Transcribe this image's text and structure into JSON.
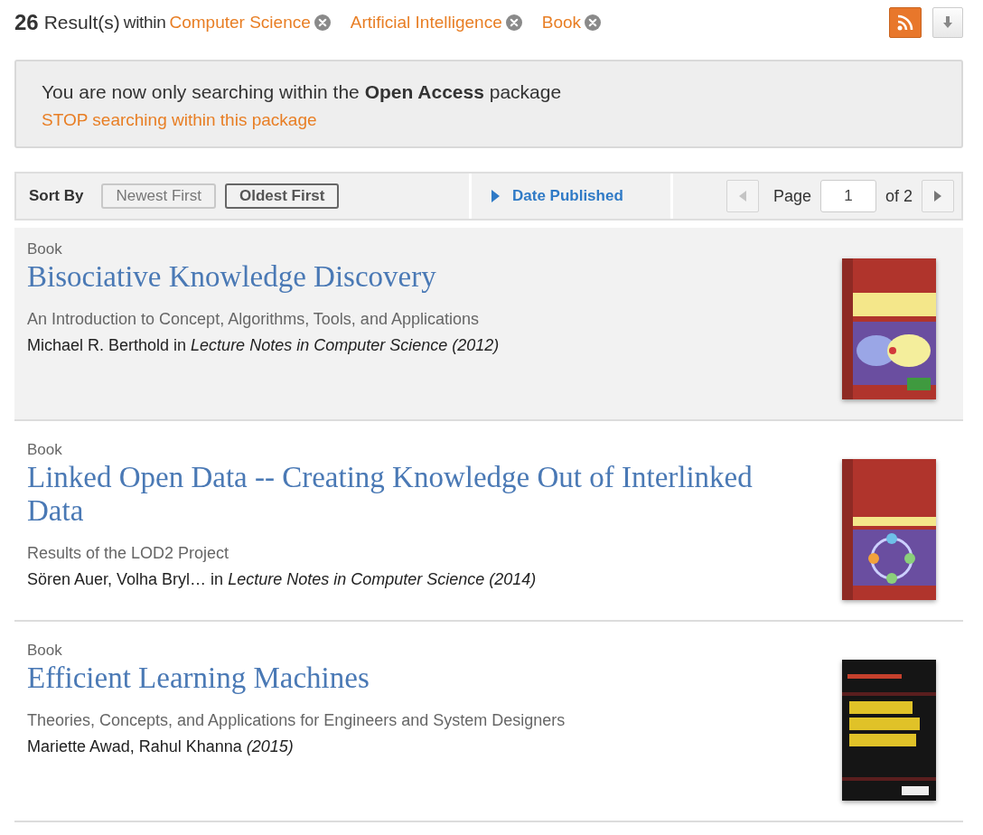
{
  "header": {
    "count": "26",
    "label": "Result(s)",
    "within": "within",
    "filters": [
      {
        "label": "Computer Science"
      },
      {
        "label": "Artificial Intelligence"
      },
      {
        "label": "Book"
      }
    ]
  },
  "notice": {
    "message": "You are now only searching within the **Open Access** package",
    "link": "STOP searching within this package"
  },
  "sort_bar": {
    "label": "Sort By",
    "options": [
      {
        "label": "Newest First",
        "selected": false
      },
      {
        "label": "Oldest First",
        "selected": true
      }
    ],
    "field": "Date Published",
    "pager": {
      "label": "Page",
      "value": "1",
      "of": "of 2",
      "prev_disabled": true,
      "next_disabled": false
    }
  },
  "results": [
    {
      "type": "Book",
      "title": "Bisociative Knowledge Discovery",
      "subtitle": "An Introduction to Concept, Algorithms, Tools, and Applications",
      "byline": "Michael R. Berthold in *Lecture Notes in Computer Science (2012)*",
      "highlighted": true
    },
    {
      "type": "Book",
      "title": "Linked Open Data -- Creating Knowledge Out of Interlinked Data",
      "subtitle": "Results of the LOD2 Project",
      "byline": "Sören Auer, Volha Bryl… in *Lecture Notes in Computer Science (2014)*",
      "highlighted": false
    },
    {
      "type": "Book",
      "title": "Efficient Learning Machines",
      "subtitle": "Theories, Concepts, and Applications for Engineers and System Designers",
      "byline": "Mariette Awad, Rahul Khanna *(2015)*",
      "highlighted": false
    }
  ]
}
